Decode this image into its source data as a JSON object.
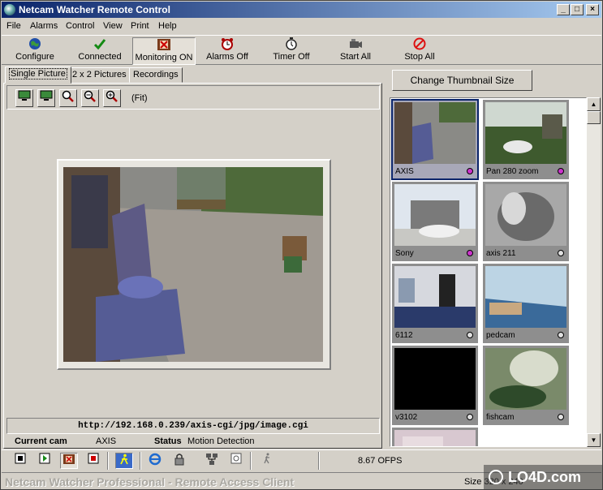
{
  "window": {
    "title": "Netcam Watcher Remote Control",
    "controls": {
      "minimize": "_",
      "maximize": "□",
      "close": "×"
    }
  },
  "menu": [
    "File",
    "Alarms",
    "Control",
    "View",
    "Print",
    "Help"
  ],
  "toolbar": [
    {
      "label": "Configure",
      "icon": "globe-icon"
    },
    {
      "label": "Connected",
      "icon": "checkmark-icon"
    },
    {
      "label": "Monitoring ON",
      "icon": "film-icon"
    },
    {
      "label": "Alarms Off",
      "icon": "alarm-clock-icon"
    },
    {
      "label": "Timer Off",
      "icon": "stopwatch-icon"
    },
    {
      "label": "Start All",
      "icon": "camera-icon"
    },
    {
      "label": "Stop All",
      "icon": "stop-icon"
    }
  ],
  "tabs": [
    "Single Picture",
    "2 x 2 Pictures",
    "Recordings"
  ],
  "viewer": {
    "fit_label": "(Fit)",
    "url": "http://192.168.0.239/axis-cgi/jpg/image.cgi",
    "current_cam_label": "Current cam",
    "current_cam": "AXIS",
    "status_label": "Status",
    "status": "Motion Detection"
  },
  "thumbnails": {
    "button_label": "Change Thumbnail Size",
    "items": [
      {
        "name": "AXIS",
        "status": "motion",
        "dot_color": "#cc33cc"
      },
      {
        "name": "Pan 280 zoom",
        "status": "motion",
        "dot_color": "#cc33cc"
      },
      {
        "name": "Sony",
        "status": "motion",
        "dot_color": "#cc33cc"
      },
      {
        "name": "axis 211",
        "status": "idle",
        "dot_color": "#e0e0e0"
      },
      {
        "name": "6112",
        "status": "idle",
        "dot_color": "#e0e0e0"
      },
      {
        "name": "pedcam",
        "status": "idle",
        "dot_color": "#e0e0e0"
      },
      {
        "name": "v3102",
        "status": "idle",
        "dot_color": "#e0e0e0"
      },
      {
        "name": "fishcam",
        "status": "idle",
        "dot_color": "#e0e0e0"
      }
    ]
  },
  "statusbar": {
    "fps": "8.67 OFPS",
    "product": "Netcam Watcher Professional - Remote Access Client",
    "size": "Size 320 x 240"
  },
  "watermark": "LO4D.com"
}
